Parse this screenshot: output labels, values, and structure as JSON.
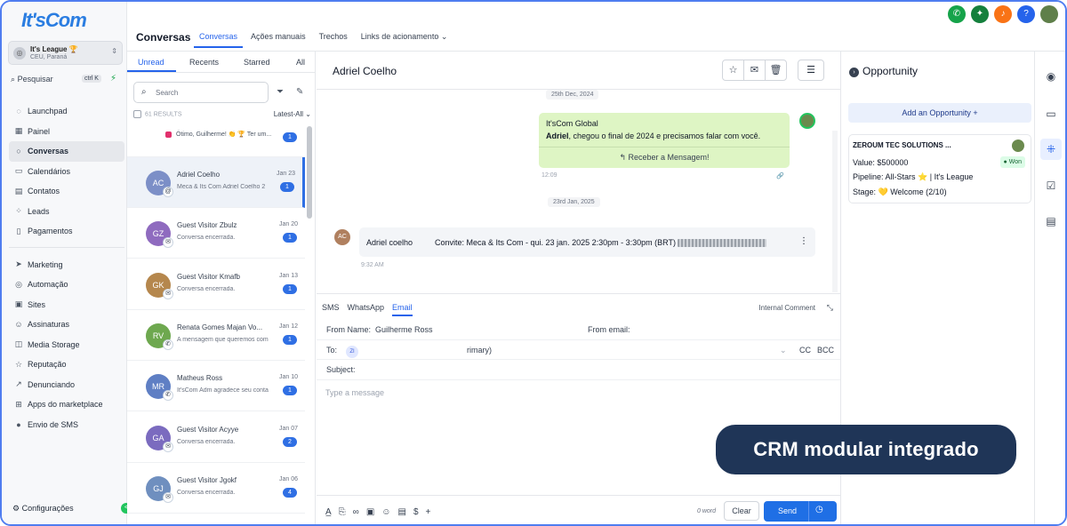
{
  "brand": {
    "logo_text": "It'sCom"
  },
  "account": {
    "name": "It's League 🏆",
    "location": "CEU, Paraná"
  },
  "sidebar": {
    "search_label": "Pesquisar",
    "search_shortcut": "ctrl K",
    "items_top": [
      {
        "label": "Launchpad",
        "icon": "rocket-icon"
      },
      {
        "label": "Painel",
        "icon": "dashboard-icon"
      },
      {
        "label": "Conversas",
        "icon": "chat-icon"
      },
      {
        "label": "Calendários",
        "icon": "calendar-icon"
      },
      {
        "label": "Contatos",
        "icon": "contacts-icon"
      },
      {
        "label": "Leads",
        "icon": "leads-icon"
      },
      {
        "label": "Pagamentos",
        "icon": "payments-icon"
      }
    ],
    "items_bottom": [
      {
        "label": "Marketing",
        "icon": "send-icon"
      },
      {
        "label": "Automação",
        "icon": "automation-icon"
      },
      {
        "label": "Sites",
        "icon": "sites-icon"
      },
      {
        "label": "Assinaturas",
        "icon": "members-icon"
      },
      {
        "label": "Media Storage",
        "icon": "storage-icon"
      },
      {
        "label": "Reputação",
        "icon": "star-icon"
      },
      {
        "label": "Denunciando",
        "icon": "reporting-icon"
      },
      {
        "label": "Apps do marketplace",
        "icon": "apps-icon"
      },
      {
        "label": "Envio de SMS",
        "icon": "sms-icon"
      }
    ],
    "settings_label": "Configurações",
    "settings_badge": "<"
  },
  "topbar": {
    "title": "Conversas",
    "tabs": [
      "Conversas",
      "Ações manuais",
      "Trechos",
      "Links de acionamento"
    ],
    "active_tab": "Conversas"
  },
  "convlist": {
    "tabs": [
      "Unread",
      "Recents",
      "Starred",
      "All"
    ],
    "active_tab": "Unread",
    "search_placeholder": "Search",
    "results_count": "61 RESULTS",
    "sort": "Latest-All",
    "first_preview": "Ótimo, Guilherme! 👏 🏆 Ter um...",
    "first_count": "1",
    "items": [
      {
        "initials": "AC",
        "name": "Adriel Coelho",
        "preview": "Meca & Its Com Adriel Coelho 2",
        "date": "Jan 23",
        "count": "1",
        "color": "#7c8fc7",
        "channel": "@"
      },
      {
        "initials": "GZ",
        "name": "Guest Visitor Zbulz",
        "preview": "Conversa encerrada.",
        "date": "Jan 20",
        "count": "1",
        "color": "#8f6bbf",
        "channel": "✉"
      },
      {
        "initials": "GK",
        "name": "Guest Visitor Kmafb",
        "preview": "Conversa encerrada.",
        "date": "Jan 13",
        "count": "1",
        "color": "#b5874d",
        "channel": "✉"
      },
      {
        "initials": "RV",
        "name": "Renata Gomes Majan Vo...",
        "preview": "A mensagem que queremos com",
        "date": "Jan 12",
        "count": "1",
        "color": "#6ea84f",
        "channel": "✆"
      },
      {
        "initials": "MR",
        "name": "Matheus Ross",
        "preview": "It'sCom Adm agradece seu conta",
        "date": "Jan 10",
        "count": "1",
        "color": "#5f7fc4",
        "channel": "✆"
      },
      {
        "initials": "GA",
        "name": "Guest Visitor Acyye",
        "preview": "Conversa encerrada.",
        "date": "Jan 07",
        "count": "2",
        "color": "#7b6bbf",
        "channel": "✉"
      },
      {
        "initials": "GJ",
        "name": "Guest Visitor Jgokf",
        "preview": "Conversa encerrada.",
        "date": "Jan 06",
        "count": "4",
        "color": "#6f8fbf",
        "channel": "✉"
      }
    ]
  },
  "chat": {
    "contact_name": "Adriel Coelho",
    "date1": "25th Dec, 2024",
    "msg1_sender": "It'sCom Global",
    "msg1_name": "Adriel",
    "msg1_text": ", chegou o final de 2024 e precisamos falar com você.",
    "msg1_reply": "Receber a Mensagem!",
    "msg1_time": "12:09",
    "date2": "23rd Jan, 2025",
    "msg2_sender": "Adriel coelho",
    "msg2_text": "Convite: Meca & Its Com - qui. 23 jan. 2025 2:30pm - 3:30pm (BRT)",
    "msg2_initials": "AC",
    "msg2_time": "9:32 AM"
  },
  "composer": {
    "tabs": [
      "SMS",
      "WhatsApp",
      "Email"
    ],
    "active_tab": "Email",
    "internal_comment": "Internal Comment",
    "from_name_label": "From Name:",
    "from_name_value": "Guilherme  Ross",
    "from_email_label": "From email:",
    "to_label": "To:",
    "to_chip": "ZI",
    "to_suffix": "rimary)",
    "cc": "CC",
    "bcc": "BCC",
    "subject_label": "Subject:",
    "message_placeholder": "Type a message",
    "word_count": "0 word",
    "clear_label": "Clear",
    "send_label": "Send"
  },
  "opportunity": {
    "title": "Opportunity",
    "add_label": "Add an Opportunity",
    "card_title": "ZEROUM TEC SOLUTIONS ...",
    "value": "Value: $500000",
    "status": "Won",
    "pipeline": "Pipeline: All-Stars ⭐ | It's League",
    "stage": "Stage: 💛 Welcome (2/10)"
  },
  "overlay": {
    "text": "CRM modular integrado"
  },
  "colors": {
    "accent": "#2563eb",
    "pill": "#1f3557",
    "bubble": "#def5c4"
  }
}
